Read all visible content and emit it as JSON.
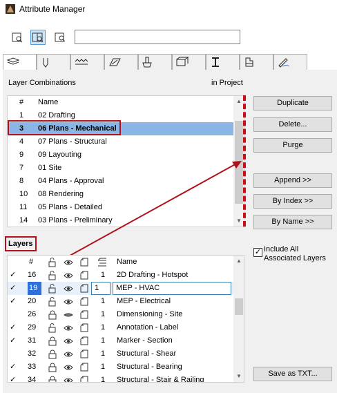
{
  "window": {
    "title": "Attribute Manager",
    "icon": "archicad-icon"
  },
  "toolbar": {
    "buttons": [
      "view-left-icon",
      "view-both-icon",
      "view-right-icon"
    ],
    "search_value": ""
  },
  "tabs": [
    {
      "icon": "layers-icon",
      "active": true
    },
    {
      "icon": "pen-icon"
    },
    {
      "icon": "line-types-icon"
    },
    {
      "icon": "fills-icon"
    },
    {
      "icon": "surfaces-icon"
    },
    {
      "icon": "building-materials-icon"
    },
    {
      "icon": "profiles-icon"
    },
    {
      "icon": "zone-categories-icon"
    },
    {
      "icon": "markup-styles-icon"
    }
  ],
  "combinations": {
    "title": "Layer Combinations",
    "in_project": "in Project",
    "col_num": "#",
    "col_name": "Name",
    "rows": [
      {
        "num": "1",
        "name": "02 Drafting"
      },
      {
        "num": "3",
        "name": "06 Plans - Mechanical",
        "selected": true
      },
      {
        "num": "4",
        "name": "07 Plans - Structural"
      },
      {
        "num": "9",
        "name": "09 Layouting"
      },
      {
        "num": "7",
        "name": "01 Site"
      },
      {
        "num": "8",
        "name": "04 Plans - Approval"
      },
      {
        "num": "10",
        "name": "08 Rendering"
      },
      {
        "num": "11",
        "name": "05 Plans - Detailed"
      },
      {
        "num": "14",
        "name": "03 Plans - Preliminary"
      }
    ]
  },
  "actions": {
    "duplicate": "Duplicate",
    "delete": "Delete...",
    "purge": "Purge",
    "append": "Append >>",
    "by_index": "By Index >>",
    "by_name": "By Name >>",
    "save_txt": "Save as TXT..."
  },
  "layers": {
    "title": "Layers",
    "col_num": "#",
    "col_name": "Name",
    "include_all_label": "Include All\nAssociated Layers",
    "include_all_checked": "✓",
    "rows": [
      {
        "check": "✓",
        "num": "16",
        "lock": "unlocked",
        "view": "eye",
        "wire": "solid",
        "intersection": "1",
        "name": "2D Drafting - Hotspot"
      },
      {
        "check": "✓",
        "num": "19",
        "lock": "unlocked",
        "view": "eye",
        "wire": "solid",
        "intersection": "1",
        "name": "MEP - HVAC",
        "selected": true
      },
      {
        "check": "✓",
        "num": "20",
        "lock": "unlocked",
        "view": "eye",
        "wire": "solid",
        "intersection": "1",
        "name": "MEP - Electrical"
      },
      {
        "check": "",
        "num": "26",
        "lock": "locked",
        "view": "hidden",
        "wire": "solid",
        "intersection": "1",
        "name": "Dimensioning - Site"
      },
      {
        "check": "✓",
        "num": "29",
        "lock": "unlocked",
        "view": "eye",
        "wire": "solid",
        "intersection": "1",
        "name": "Annotation - Label"
      },
      {
        "check": "✓",
        "num": "31",
        "lock": "locked",
        "view": "eye",
        "wire": "solid",
        "intersection": "1",
        "name": "Marker - Section"
      },
      {
        "check": "",
        "num": "32",
        "lock": "locked",
        "view": "eye",
        "wire": "solid",
        "intersection": "1",
        "name": "Structural - Shear"
      },
      {
        "check": "✓",
        "num": "33",
        "lock": "locked",
        "view": "eye",
        "wire": "solid",
        "intersection": "1",
        "name": "Structural - Bearing"
      },
      {
        "check": "✓",
        "num": "34",
        "lock": "locked",
        "view": "eye",
        "wire": "solid",
        "intersection": "1",
        "name": "Structural - Stair & Railing"
      }
    ]
  },
  "colors": {
    "selection": "#89b6e6",
    "annotation_red": "#b0121b",
    "panel_bg": "#f0f0f0"
  }
}
